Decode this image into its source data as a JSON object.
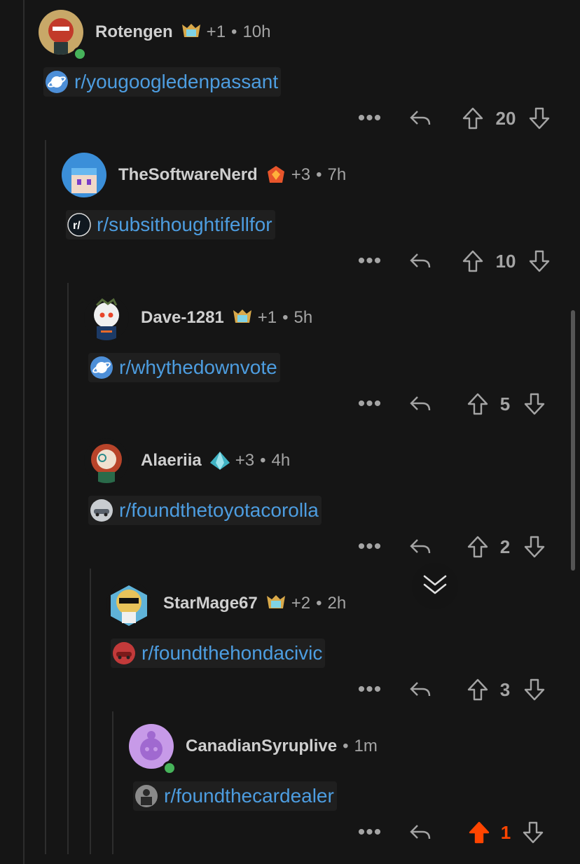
{
  "thread": {
    "comments": [
      {
        "username": "Rotengen",
        "karma": "+1",
        "time": "10h",
        "subreddit": "r/yougoogledenpassant",
        "score": "20"
      },
      {
        "username": "TheSoftwareNerd",
        "karma": "+3",
        "time": "7h",
        "subreddit": "r/subsithoughtifellfor",
        "score": "10"
      },
      {
        "username": "Dave-1281",
        "karma": "+1",
        "time": "5h",
        "subreddit": "r/whythedownvote",
        "score": "5"
      },
      {
        "username": "Alaeriia",
        "karma": "+3",
        "time": "4h",
        "subreddit": "r/foundthetoyotacorolla",
        "score": "2"
      },
      {
        "username": "StarMage67",
        "karma": "+2",
        "time": "2h",
        "subreddit": "r/foundthehondacivic",
        "score": "3"
      },
      {
        "username": "CanadianSyruplive",
        "karma": "",
        "time": "1m",
        "subreddit": "r/foundthecardealer",
        "score": "1"
      }
    ],
    "separator": "•",
    "more_label": "•••"
  },
  "colors": {
    "background": "#151515",
    "link": "#4d9de0",
    "upvote_active": "#ff4500",
    "muted": "#a4a4a4"
  },
  "icons": [
    "avatar",
    "flair-badge-icon",
    "subreddit-icon",
    "reply-icon",
    "upvote-icon",
    "downvote-icon",
    "more-options-icon",
    "jump-down-icon"
  ]
}
